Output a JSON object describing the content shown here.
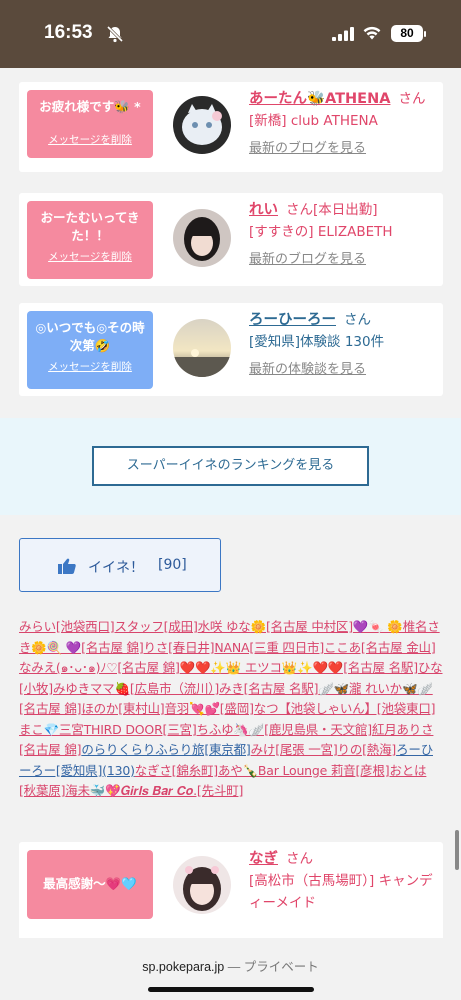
{
  "status_bar": {
    "time": "16:53",
    "battery": "80",
    "icons": [
      "bell-slash-icon",
      "signal-icon",
      "wifi-icon",
      "battery-icon"
    ]
  },
  "cards": [
    {
      "message": "お疲れ様です🐝 *",
      "delete_label": "メッセージを削除",
      "name": "あーたん🐝ATHENA",
      "san": "さん",
      "shop": "[新橋] club ATHENA",
      "latest": "最新のブログを見る",
      "bubble_color": "#f58a9f",
      "name_color": "#e0466a"
    },
    {
      "message": "おーたむいってきた！！",
      "delete_label": "メッセージを削除",
      "name": "れい",
      "san": "さん",
      "shop_prefix": "[本日出勤]",
      "shop": "[すすきの] ELIZABETH",
      "latest": "最新のブログを見る",
      "bubble_color": "#f58a9f",
      "name_color": "#e0466a"
    },
    {
      "message": "◎いつでも◎その時次第🤣",
      "delete_label": "メッセージを削除",
      "name": "ろーひーろー",
      "san": "さん",
      "shop": "[愛知県]体験談 130件",
      "latest": "最新の体験談を見る",
      "bubble_color": "#7eaef6",
      "name_color": "#2d6a93"
    },
    {
      "message": "最高感謝〜💗🩵",
      "name": "なぎ",
      "san": "さん",
      "shop": "[高松市（古馬場町）] キャンディーメイド",
      "bubble_color": "#f58a9f",
      "name_color": "#e0466a"
    }
  ],
  "ranking_button": "スーパーイイネのランキングを見る",
  "like_button": {
    "label": "イイネ！",
    "count": "[90]"
  },
  "likers": [
    {
      "t": "みらい[池袋西口]"
    },
    {
      "t": "スタッフ[成田]"
    },
    {
      "t": "水咲 ゆな🌼[名古屋 中村区]"
    },
    {
      "t": "💜🍬 🌼椎名さき🌼🍭 💜[名古屋 錦]"
    },
    {
      "t": "りさ[春日井]"
    },
    {
      "t": "NANA[三重 四日市]"
    },
    {
      "t": "ここあ[名古屋 金山]"
    },
    {
      "t": "なみえ(๑･ᴗ･๑)ﾉ♡[名古屋 錦]"
    },
    {
      "t": "❤️❤️✨👑 エツコ👑✨❤️❤️[名古屋 名駅]"
    },
    {
      "t": "ひな[小牧]"
    },
    {
      "t": "みゆきママ🍓[広島市（流川）]"
    },
    {
      "t": "みき[名古屋 名駅]"
    },
    {
      "t": "🪽🦋瀧 れいか🦋🪽[名古屋 錦]"
    },
    {
      "t": "ほのか[東村山]"
    },
    {
      "t": "音羽💘💕[盛岡]"
    },
    {
      "t": "なつ【池袋しゃいん】[池袋東口]"
    },
    {
      "t": "まこ💎三宮THIRD DOOR[三宮]"
    },
    {
      "t": "ちふゆ🦄🪽[鹿児島県・天文館]"
    },
    {
      "t": "紅月ありさ[名古屋 錦]"
    },
    {
      "t": "のらりくらりふらり旅[東京都]",
      "blue": true
    },
    {
      "t": "みけ[尾張 一宮]"
    },
    {
      "t": "りの[熱海]"
    },
    {
      "t": "ろーひーろー[愛知県](130)",
      "blue": true
    },
    {
      "t": "なぎさ[錦糸町]"
    },
    {
      "t": "あや🍾Bar Lounge 莉音[彦根]"
    },
    {
      "t": "おとは[秋葉原]"
    },
    {
      "t": "海未🐳💖𝑮𝒊𝒓𝒍𝒔 𝑩𝒂𝒓 𝑪𝒐.[先斗町]"
    }
  ],
  "browser": {
    "domain": "sp.pokepara.jp",
    "separator": " — ",
    "mode": "プライベート"
  }
}
